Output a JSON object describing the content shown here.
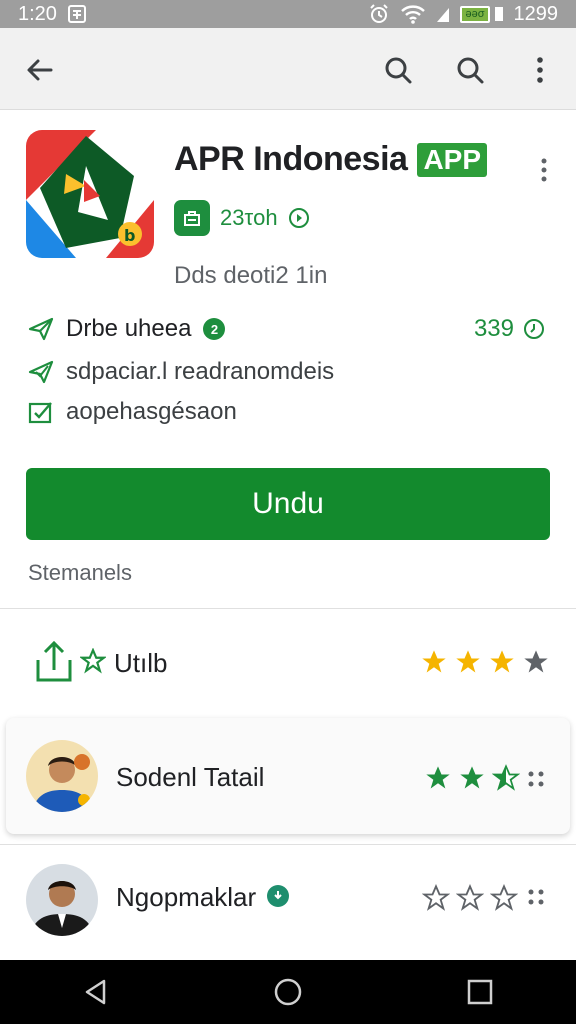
{
  "status_bar": {
    "time": "1:20",
    "battery_label": "ǝǝσ",
    "right_time": "1299"
  },
  "app": {
    "title": "APR Indonesia",
    "badge": "APP",
    "size": "23τoh",
    "developer": "Dds deoti2 1in"
  },
  "features": [
    {
      "label": "Drbe uheea"
    },
    {
      "label": "sdpaciar.l readranomdeis"
    },
    {
      "label": "aopehasgésaon"
    }
  ],
  "feature_count": "339",
  "install_button": {
    "label": "Undu"
  },
  "summary": "Stemanels",
  "rows": [
    {
      "label": "Utılb",
      "stars_filled": 3.0,
      "stars_total": 4
    },
    {
      "label": "Sodenl Tatail",
      "stars_filled": 2.5,
      "stars_total": 3
    },
    {
      "label": "Ngopmaklar",
      "stars_filled": 0,
      "stars_total": 3
    }
  ],
  "colors": {
    "accent": "#138a2d",
    "star_gold": "#f5b400",
    "star_green": "#1e8e3e",
    "star_empty": "#5f6368"
  },
  "icons": [
    "back-arrow-icon",
    "search-icon",
    "more-vert-icon",
    "wifi-icon",
    "battery-icon",
    "alarm-icon",
    "share-icon",
    "check-icon"
  ]
}
